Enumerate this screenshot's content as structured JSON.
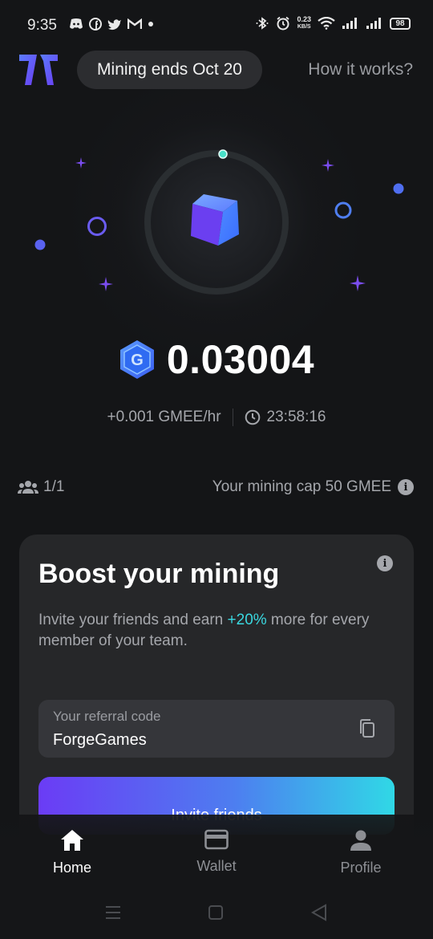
{
  "status_bar": {
    "time": "9:35",
    "net_speed_value": "0.23",
    "net_speed_unit": "KB/S",
    "battery": "98"
  },
  "header": {
    "mining_ends": "Mining ends Oct 20",
    "how_it_works": "How it works?"
  },
  "mining": {
    "balance": "0.03004",
    "rate": "+0.001 GMEE/hr",
    "timer": "23:58:16",
    "team_count": "1/1",
    "cap": "Your mining cap 50 GMEE"
  },
  "boost": {
    "title": "Boost your mining",
    "desc_before": "Invite your friends and earn ",
    "desc_highlight": "+20%",
    "desc_after": " more for every member of your team.",
    "referral_label": "Your referral code",
    "referral_code": "ForgeGames",
    "invite_label": "Invite friends"
  },
  "nav": {
    "home": "Home",
    "wallet": "Wallet",
    "profile": "Profile"
  },
  "colors": {
    "background": "#141517",
    "card": "#262729",
    "accent_cyan": "#3ad8e0",
    "accent_purple": "#6b3cf5",
    "accent_blue": "#4d7ef0"
  },
  "icons": [
    "discord-icon",
    "facebook-icon",
    "twitter-icon",
    "gmail-icon",
    "bluetooth-icon",
    "alarm-icon",
    "wifi-icon",
    "signal-icon",
    "battery-icon",
    "clock-icon",
    "team-icon",
    "info-icon",
    "copy-icon",
    "home-icon",
    "wallet-icon",
    "profile-icon"
  ]
}
